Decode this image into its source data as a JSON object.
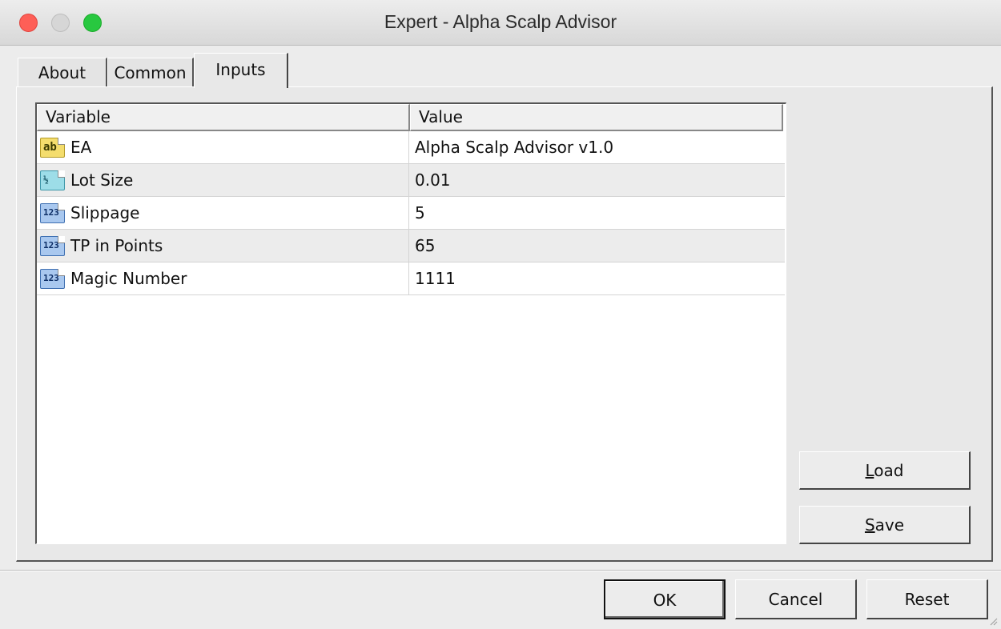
{
  "window": {
    "title": "Expert - Alpha Scalp Advisor"
  },
  "tabs": [
    {
      "label": "About"
    },
    {
      "label": "Common"
    },
    {
      "label": "Inputs",
      "active": true
    }
  ],
  "grid": {
    "columns": [
      "Variable",
      "Value"
    ],
    "rows": [
      {
        "variable": "EA",
        "value": "Alpha Scalp Advisor v1.0",
        "type_icon": "string-type-icon",
        "icon_text": "ab"
      },
      {
        "variable": "Lot Size",
        "value": "0.01",
        "type_icon": "double-type-icon",
        "icon_text": "½"
      },
      {
        "variable": "Slippage",
        "value": "5",
        "type_icon": "integer-type-icon",
        "icon_text": "123"
      },
      {
        "variable": "TP in Points",
        "value": "65",
        "type_icon": "integer-type-icon",
        "icon_text": "123"
      },
      {
        "variable": "Magic Number",
        "value": "1111",
        "type_icon": "integer-type-icon",
        "icon_text": "123"
      }
    ]
  },
  "side_buttons": {
    "load_prefix": "L",
    "load_rest": "oad",
    "save_prefix": "S",
    "save_rest": "ave"
  },
  "footer_buttons": {
    "ok": "OK",
    "cancel": "Cancel",
    "reset": "Reset"
  },
  "colors": {
    "close": "#fe5f57",
    "minimize_disabled": "#d6d6d6",
    "zoom": "#28c840"
  }
}
